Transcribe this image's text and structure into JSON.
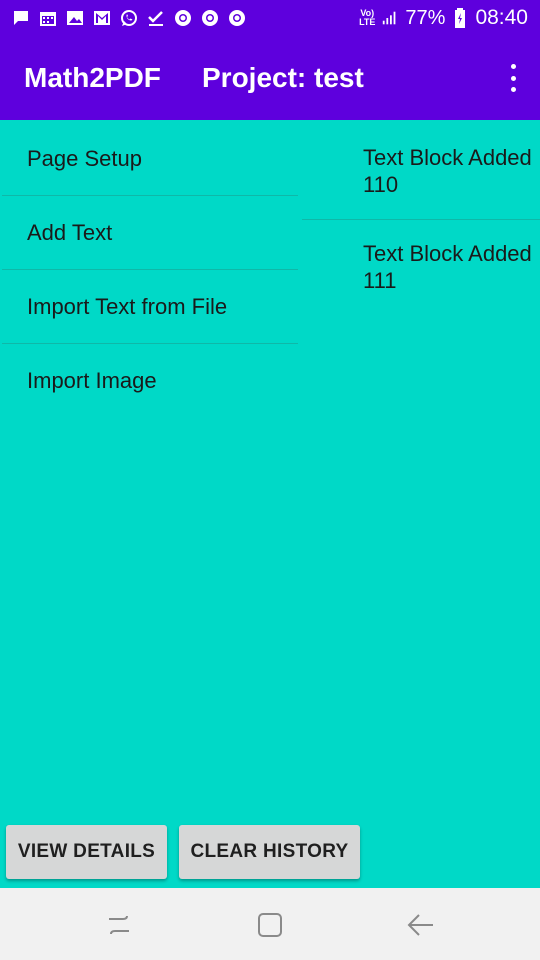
{
  "status_bar": {
    "network": "VoLTE",
    "battery": "77%",
    "time": "08:40",
    "icons": [
      "message-icon",
      "calendar-icon",
      "photo-icon",
      "gmail-icon",
      "whatsapp-icon",
      "check-icon",
      "chrome-icon",
      "chrome-icon",
      "chrome-icon"
    ]
  },
  "app_bar": {
    "title": "Math2PDF",
    "project": "Project: test"
  },
  "menu": {
    "items": [
      {
        "label": "Page Setup"
      },
      {
        "label": "Add Text"
      },
      {
        "label": "Import Text from File"
      },
      {
        "label": "Import Image"
      }
    ]
  },
  "history": {
    "items": [
      {
        "line1": "Text Block Added",
        "line2": "110"
      },
      {
        "line1": "Text Block Added",
        "line2": "111"
      }
    ]
  },
  "buttons": {
    "view_details": "VIEW DETAILS",
    "clear_history": "CLEAR HISTORY"
  },
  "colors": {
    "app_bar": "#5E00DD",
    "background": "#00D9C7",
    "button": "#D6D7D7"
  }
}
